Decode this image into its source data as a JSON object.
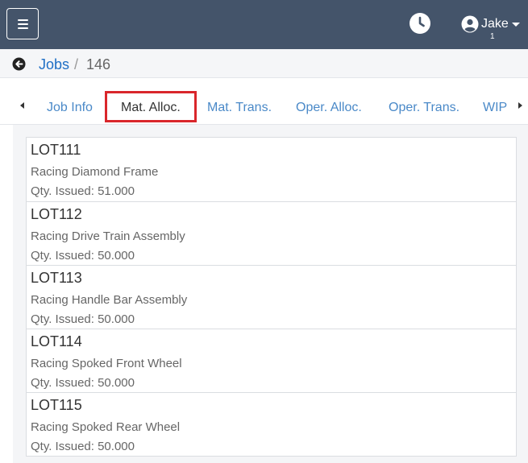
{
  "navbar": {
    "menu_icon": "hamburger-icon",
    "clock_icon": "clock-icon",
    "user_icon": "user-circle-icon",
    "user_name": "Jake",
    "user_badge": "1",
    "background_color": "#44546a"
  },
  "breadcrumb": {
    "back_icon": "arrow-left-circle-icon",
    "parent": "Jobs",
    "separator": "/",
    "current": "146"
  },
  "tabs": [
    {
      "label": "Job Info",
      "active": false
    },
    {
      "label": "Mat. Alloc.",
      "active": true
    },
    {
      "label": "Mat. Trans.",
      "active": false
    },
    {
      "label": "Oper. Alloc.",
      "active": false
    },
    {
      "label": "Oper. Trans.",
      "active": false
    },
    {
      "label": "WIP",
      "active": false
    }
  ],
  "materials": [
    {
      "lot": "LOT111",
      "description": "Racing Diamond Frame",
      "qty": "Qty. Issued: 51.000"
    },
    {
      "lot": "LOT112",
      "description": "Racing Drive Train Assembly",
      "qty": "Qty. Issued: 50.000"
    },
    {
      "lot": "LOT113",
      "description": "Racing Handle Bar Assembly",
      "qty": "Qty. Issued: 50.000"
    },
    {
      "lot": "LOT114",
      "description": "Racing Spoked Front Wheel",
      "qty": "Qty. Issued: 50.000"
    },
    {
      "lot": "LOT115",
      "description": "Racing Spoked Rear Wheel",
      "qty": "Qty. Issued: 50.000"
    }
  ],
  "colors": {
    "link": "#1f6fc5",
    "tab_link": "#4a89c8",
    "active_tab_highlight": "#d9262b"
  }
}
